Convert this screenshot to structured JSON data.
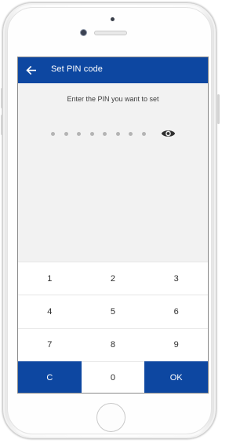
{
  "colors": {
    "primary": "#0d47a1",
    "screen_background": "#f2f2f2",
    "pin_dot": "#b4b4b4"
  },
  "app_bar": {
    "back_icon": "arrow-left-icon",
    "title": "Set PIN code"
  },
  "pin_entry": {
    "instruction": "Enter the PIN you want to set",
    "dot_count": 8,
    "visibility_icon": "eye-icon"
  },
  "keypad": {
    "keys": [
      "1",
      "2",
      "3",
      "4",
      "5",
      "6",
      "7",
      "8",
      "9",
      "C",
      "0",
      "OK"
    ]
  }
}
